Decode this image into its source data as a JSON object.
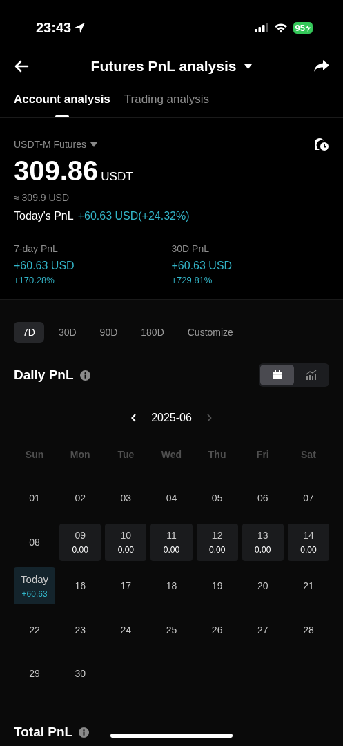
{
  "status_bar": {
    "time": "23:43",
    "battery": "95"
  },
  "header": {
    "title": "Futures PnL analysis"
  },
  "tabs": [
    {
      "label": "Account analysis",
      "selected": true
    },
    {
      "label": "Trading analysis",
      "selected": false
    }
  ],
  "account": {
    "type": "USDT-M Futures",
    "balance": "309.86",
    "currency": "USDT",
    "approx": "≈ 309.9 USD",
    "today_label": "Today's PnL",
    "today_value": "+60.63 USD(+24.32%)"
  },
  "stats": [
    {
      "label": "7-day PnL",
      "value": "+60.63 USD",
      "percent": "+170.28%"
    },
    {
      "label": "30D PnL",
      "value": "+60.63 USD",
      "percent": "+729.81%"
    }
  ],
  "ranges": [
    {
      "label": "7D",
      "selected": true
    },
    {
      "label": "30D",
      "selected": false
    },
    {
      "label": "90D",
      "selected": false
    },
    {
      "label": "180D",
      "selected": false
    },
    {
      "label": "Customize",
      "selected": false
    }
  ],
  "daily": {
    "title": "Daily PnL",
    "views": [
      {
        "kind": "calendar",
        "selected": true
      },
      {
        "kind": "chart",
        "selected": false
      }
    ]
  },
  "calendar": {
    "month": "2025-06",
    "weekdays": [
      "Sun",
      "Mon",
      "Tue",
      "Wed",
      "Thu",
      "Fri",
      "Sat"
    ],
    "days": [
      {
        "kind": "plain",
        "day": "01"
      },
      {
        "kind": "plain",
        "day": "02"
      },
      {
        "kind": "plain",
        "day": "03"
      },
      {
        "kind": "plain",
        "day": "04"
      },
      {
        "kind": "plain",
        "day": "05"
      },
      {
        "kind": "plain",
        "day": "06"
      },
      {
        "kind": "plain",
        "day": "07"
      },
      {
        "kind": "plain",
        "day": "08"
      },
      {
        "kind": "pnl",
        "day": "09",
        "pnl": "0.00"
      },
      {
        "kind": "pnl",
        "day": "10",
        "pnl": "0.00"
      },
      {
        "kind": "pnl",
        "day": "11",
        "pnl": "0.00"
      },
      {
        "kind": "pnl",
        "day": "12",
        "pnl": "0.00"
      },
      {
        "kind": "pnl",
        "day": "13",
        "pnl": "0.00"
      },
      {
        "kind": "pnl",
        "day": "14",
        "pnl": "0.00"
      },
      {
        "kind": "today",
        "day": "Today",
        "pnl": "+60.63"
      },
      {
        "kind": "plain",
        "day": "16"
      },
      {
        "kind": "plain",
        "day": "17"
      },
      {
        "kind": "plain",
        "day": "18"
      },
      {
        "kind": "plain",
        "day": "19"
      },
      {
        "kind": "plain",
        "day": "20"
      },
      {
        "kind": "plain",
        "day": "21"
      },
      {
        "kind": "plain",
        "day": "22"
      },
      {
        "kind": "plain",
        "day": "23"
      },
      {
        "kind": "plain",
        "day": "24"
      },
      {
        "kind": "plain",
        "day": "25"
      },
      {
        "kind": "plain",
        "day": "26"
      },
      {
        "kind": "plain",
        "day": "27"
      },
      {
        "kind": "plain",
        "day": "28"
      },
      {
        "kind": "plain",
        "day": "29"
      },
      {
        "kind": "plain",
        "day": "30"
      }
    ]
  },
  "total": {
    "title": "Total PnL"
  }
}
